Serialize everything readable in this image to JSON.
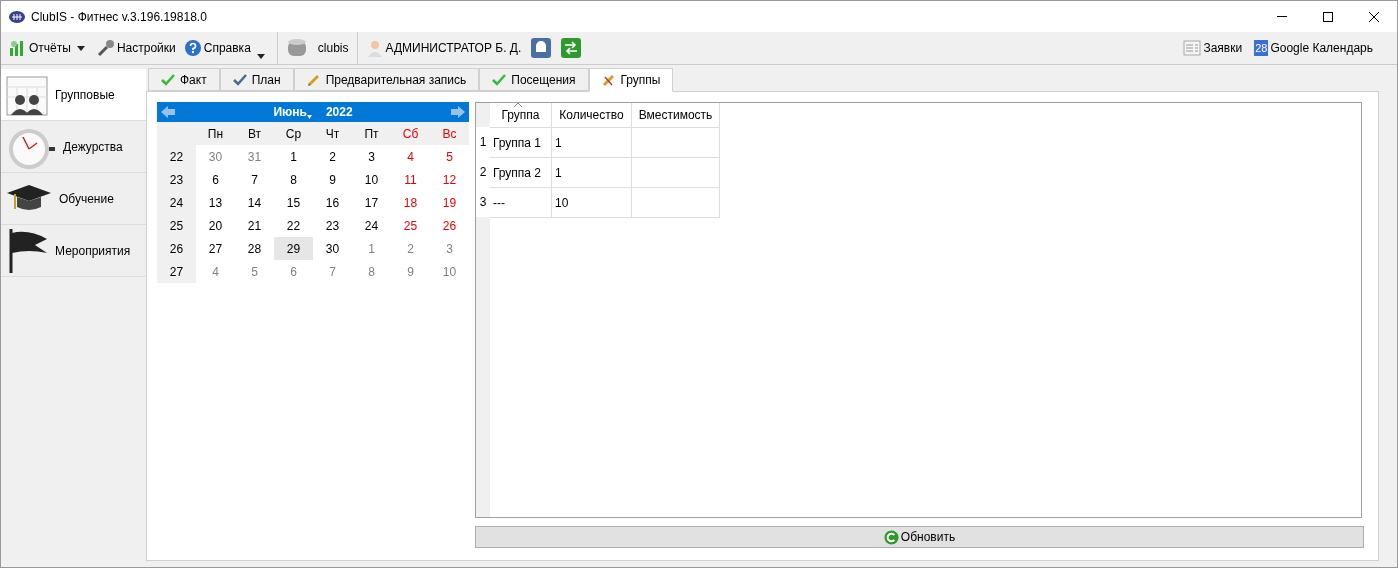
{
  "window": {
    "title": "ClubIS - Фитнес v.3.196.19818.0"
  },
  "toolbar": {
    "left": [
      {
        "label": "Отчёты",
        "kind": "reports",
        "dropdown": true
      },
      {
        "label": "Настройки",
        "kind": "settings",
        "dropdown": false
      },
      {
        "label": "Справка",
        "kind": "help",
        "dropdown": true
      },
      {
        "label": "clubis",
        "kind": "database",
        "dropdown": false
      },
      {
        "label": "АДМИНИСТРАТОР Б. Д.",
        "kind": "user",
        "dropdown": false
      }
    ],
    "right": [
      {
        "label": "Заявки",
        "kind": "list"
      },
      {
        "label": "Google Календарь",
        "kind": "calendar",
        "badge": "28"
      }
    ]
  },
  "sidebar": {
    "items": [
      {
        "label": "Групповые",
        "kind": "group",
        "selected": true
      },
      {
        "label": "Дежурства",
        "kind": "clock",
        "selected": false
      },
      {
        "label": "Обучение",
        "kind": "cap",
        "selected": false
      },
      {
        "label": "Мероприятия",
        "kind": "flag",
        "selected": false
      }
    ]
  },
  "tabs": [
    {
      "label": "Факт",
      "kind": "check",
      "selected": false
    },
    {
      "label": "План",
      "kind": "checkblue",
      "selected": false
    },
    {
      "label": "Предварительная запись",
      "kind": "pencil",
      "selected": false
    },
    {
      "label": "Посещения",
      "kind": "check",
      "selected": false
    },
    {
      "label": "Группы",
      "kind": "tools",
      "selected": true
    }
  ],
  "calendar": {
    "month": "Июнь",
    "year": "2022",
    "weekdays": [
      {
        "label": "Пн",
        "weekend": false
      },
      {
        "label": "Вт",
        "weekend": false
      },
      {
        "label": "Ср",
        "weekend": false
      },
      {
        "label": "Чт",
        "weekend": false
      },
      {
        "label": "Пт",
        "weekend": false
      },
      {
        "label": "Сб",
        "weekend": true
      },
      {
        "label": "Вс",
        "weekend": true
      }
    ],
    "weeks": [
      {
        "number": "22",
        "days": [
          {
            "text": "30",
            "kind": "other",
            "selected": false
          },
          {
            "text": "31",
            "kind": "other",
            "selected": false
          },
          {
            "text": "1",
            "kind": "day",
            "selected": false
          },
          {
            "text": "2",
            "kind": "day",
            "selected": false
          },
          {
            "text": "3",
            "kind": "day",
            "selected": false
          },
          {
            "text": "4",
            "kind": "weekend",
            "selected": false
          },
          {
            "text": "5",
            "kind": "weekend",
            "selected": false
          }
        ]
      },
      {
        "number": "23",
        "days": [
          {
            "text": "6",
            "kind": "day",
            "selected": false
          },
          {
            "text": "7",
            "kind": "day",
            "selected": false
          },
          {
            "text": "8",
            "kind": "day",
            "selected": false
          },
          {
            "text": "9",
            "kind": "day",
            "selected": false
          },
          {
            "text": "10",
            "kind": "day",
            "selected": false
          },
          {
            "text": "11",
            "kind": "weekend",
            "selected": false
          },
          {
            "text": "12",
            "kind": "weekend",
            "selected": false
          }
        ]
      },
      {
        "number": "24",
        "days": [
          {
            "text": "13",
            "kind": "day",
            "selected": false
          },
          {
            "text": "14",
            "kind": "day",
            "selected": false
          },
          {
            "text": "15",
            "kind": "day",
            "selected": false
          },
          {
            "text": "16",
            "kind": "day",
            "selected": false
          },
          {
            "text": "17",
            "kind": "day",
            "selected": false
          },
          {
            "text": "18",
            "kind": "weekend",
            "selected": false
          },
          {
            "text": "19",
            "kind": "weekend",
            "selected": false
          }
        ]
      },
      {
        "number": "25",
        "days": [
          {
            "text": "20",
            "kind": "day",
            "selected": false
          },
          {
            "text": "21",
            "kind": "day",
            "selected": false
          },
          {
            "text": "22",
            "kind": "day",
            "selected": false
          },
          {
            "text": "23",
            "kind": "day",
            "selected": false
          },
          {
            "text": "24",
            "kind": "day",
            "selected": false
          },
          {
            "text": "25",
            "kind": "weekend",
            "selected": false
          },
          {
            "text": "26",
            "kind": "weekend",
            "selected": false
          }
        ]
      },
      {
        "number": "26",
        "days": [
          {
            "text": "27",
            "kind": "day",
            "selected": false
          },
          {
            "text": "28",
            "kind": "day",
            "selected": false
          },
          {
            "text": "29",
            "kind": "day",
            "selected": true
          },
          {
            "text": "30",
            "kind": "day",
            "selected": false
          },
          {
            "text": "1",
            "kind": "other",
            "selected": false
          },
          {
            "text": "2",
            "kind": "other",
            "selected": false
          },
          {
            "text": "3",
            "kind": "other",
            "selected": false
          }
        ]
      },
      {
        "number": "27",
        "days": [
          {
            "text": "4",
            "kind": "other",
            "selected": false
          },
          {
            "text": "5",
            "kind": "other",
            "selected": false
          },
          {
            "text": "6",
            "kind": "other",
            "selected": false
          },
          {
            "text": "7",
            "kind": "other",
            "selected": false
          },
          {
            "text": "8",
            "kind": "other",
            "selected": false
          },
          {
            "text": "9",
            "kind": "other",
            "selected": false
          },
          {
            "text": "10",
            "kind": "other",
            "selected": false
          }
        ]
      }
    ]
  },
  "table": {
    "columns": [
      "Группа",
      "Количество",
      "Вместимость"
    ],
    "rows": [
      {
        "number": "1",
        "cells": [
          "Группа 1",
          "1",
          ""
        ]
      },
      {
        "number": "2",
        "cells": [
          "Группа 2",
          "1",
          ""
        ]
      },
      {
        "number": "3",
        "cells": [
          "---",
          "10",
          ""
        ]
      }
    ]
  },
  "refresh_button": {
    "label": "Обновить"
  }
}
